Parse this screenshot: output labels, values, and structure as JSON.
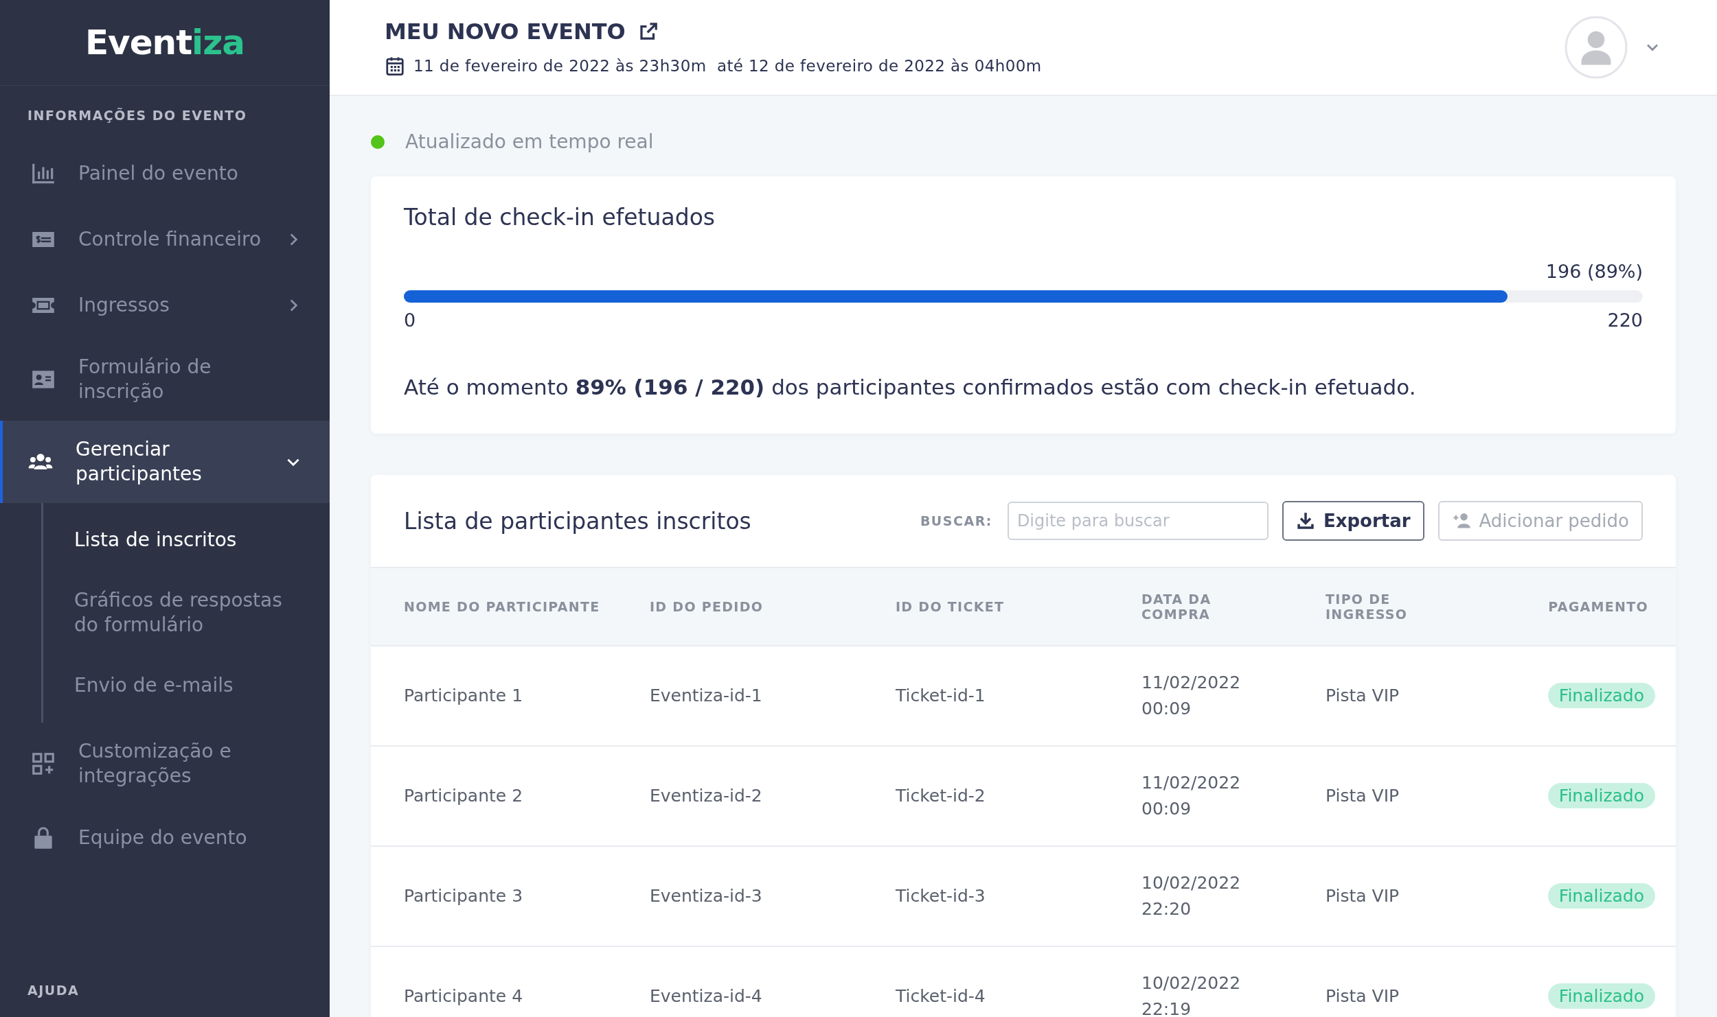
{
  "sidebar": {
    "logo": {
      "main": "Event",
      "accent": "iza"
    },
    "section_title": "INFORMAÇÕES DO EVENTO",
    "items": [
      {
        "label": "Painel do evento",
        "selected": false
      },
      {
        "label": "Controle financeiro",
        "selected": false,
        "expanded": false
      },
      {
        "label": "Ingressos",
        "selected": false,
        "expanded": false
      },
      {
        "label": "Formulário de inscrição",
        "selected": false
      },
      {
        "label": "Gerenciar participantes",
        "selected": true,
        "expanded": true,
        "children": [
          {
            "label": "Lista de inscritos",
            "selected": true
          },
          {
            "label": "Gráficos de respostas do formulário",
            "selected": false
          },
          {
            "label": "Envio de e-mails",
            "selected": false
          }
        ]
      },
      {
        "label": "Customização e integrações",
        "selected": false
      },
      {
        "label": "Equipe do evento",
        "selected": false
      }
    ],
    "help_title": "AJUDA"
  },
  "header": {
    "title": "MEU NOVO EVENTO",
    "dates": "11 de fevereiro de 2022 às 23h30m  até 12 de fevereiro de 2022 às 04h00m"
  },
  "status": {
    "label": "Atualizado em tempo real"
  },
  "checkin": {
    "title": "Total de check-in efetuados",
    "reading": "196 (89%)",
    "level": 0.891,
    "min": "0",
    "max": "220",
    "summary": "Até o momento **89% (196 / 220)** dos participantes confirmados estão com check-in efetuado."
  },
  "participants": {
    "title": "Lista de participantes inscritos",
    "search_label": "BUSCAR:",
    "search": {
      "placeholder": "Digite para buscar"
    },
    "buttons": [
      {
        "kind": "export",
        "label": "Exportar",
        "disabled": false
      },
      {
        "kind": "add",
        "label": "Adicionar pedido",
        "disabled": true
      }
    ],
    "columns": [
      "NOME DO PARTICIPANTE",
      "ID DO PEDIDO",
      "ID DO TICKET",
      "DATA DA COMPRA",
      "TIPO DE INGRESSO",
      "PAGAMENTO"
    ],
    "rows": [
      {
        "name": "Participante 1",
        "order": "Eventiza-id-1",
        "ticket": "Ticket-id-1",
        "date": "11/02/2022 00:09",
        "type": "Pista VIP",
        "payment": "Finalizado"
      },
      {
        "name": "Participante 2",
        "order": "Eventiza-id-2",
        "ticket": "Ticket-id-2",
        "date": "11/02/2022 00:09",
        "type": "Pista VIP",
        "payment": "Finalizado"
      },
      {
        "name": "Participante 3",
        "order": "Eventiza-id-3",
        "ticket": "Ticket-id-3",
        "date": "10/02/2022 22:20",
        "type": "Pista VIP",
        "payment": "Finalizado"
      },
      {
        "name": "Participante 4",
        "order": "Eventiza-id-4",
        "ticket": "Ticket-id-4",
        "date": "10/02/2022 22:19",
        "type": "Pista VIP",
        "payment": "Finalizado"
      }
    ]
  }
}
